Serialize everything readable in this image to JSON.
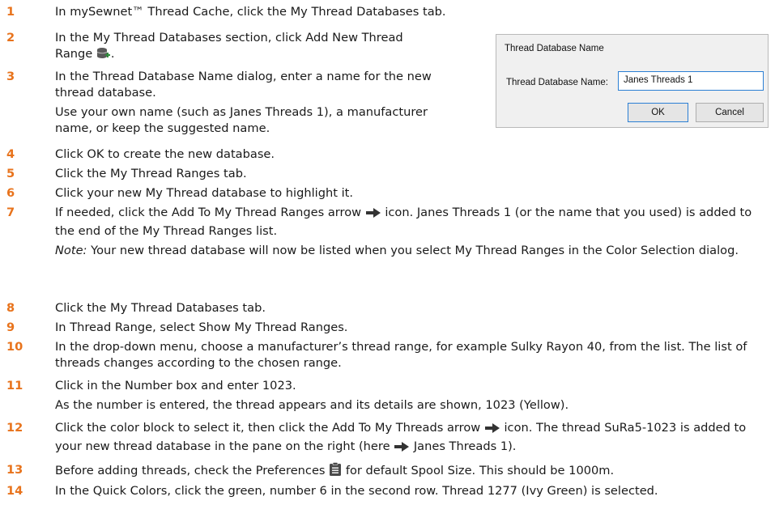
{
  "steps": [
    {
      "num": "1",
      "lines": [
        "In mySewnet™ Thread Cache, click the My Thread Databases tab."
      ]
    },
    {
      "num": "2",
      "before": "In the My Thread Databases section, click Add New Thread Range",
      "after": "."
    },
    {
      "num": "3",
      "main": "In the Thread Database Name dialog, enter a name for the new thread database.",
      "sub": "Use your own name (such as Janes Threads 1), a manufacturer name, or keep the suggested name."
    },
    {
      "num": "4",
      "lines": [
        "Click OK to create the new database."
      ]
    },
    {
      "num": "5",
      "lines": [
        "Click the My Thread Ranges tab."
      ]
    },
    {
      "num": "6",
      "lines": [
        "Click your new My Thread database to highlight it."
      ]
    },
    {
      "num": "7",
      "before": "If needed, click the Add To My Thread Ranges arrow",
      "after": "icon. Janes Threads 1 (or the name that you used) is added to the end of the My Thread Ranges list.",
      "note_label": "Note:",
      "note": "Your new thread database will now be listed when you select My Thread Ranges in the Color Selection dialog."
    },
    {
      "num": "8",
      "lines": [
        "Click the My Thread Databases tab."
      ]
    },
    {
      "num": "9",
      "lines": [
        "In Thread Range, select Show My Thread Ranges."
      ]
    },
    {
      "num": "10",
      "lines": [
        "In the drop-down menu, choose a manufacturer’s thread range, for example Sulky Rayon 40, from the list. The list of threads changes according to the chosen range."
      ]
    },
    {
      "num": "11",
      "main": "Click in the Number box and enter 1023.",
      "sub": "As the number is entered, the thread appears and its details are shown, 1023 (Yellow)."
    },
    {
      "num": "12",
      "before": "Click the color block to select it, then click the Add To My Threads arrow",
      "middle": "icon. The thread SuRa5-1023 is added to your new thread database in the pane on the right (here",
      "after": "Janes Threads 1)."
    },
    {
      "num": "13",
      "before": "Before adding threads, check the Preferences",
      "after": "for default Spool Size. This should be 1000m."
    },
    {
      "num": "14",
      "lines": [
        "In the Quick Colors, click the green, number 6 in the second row. Thread 1277 (Ivy Green) is selected."
      ]
    }
  ],
  "dialog": {
    "title": "Thread Database Name",
    "label": "Thread Database Name:",
    "value": "Janes Threads 1",
    "ok": "OK",
    "cancel": "Cancel"
  },
  "icons": {
    "add_range": "database-add-icon",
    "arrow": "right-arrow-icon",
    "preferences": "preferences-icon"
  },
  "colors": {
    "step_number": "#e8731c",
    "input_border": "#2b7fd4"
  }
}
